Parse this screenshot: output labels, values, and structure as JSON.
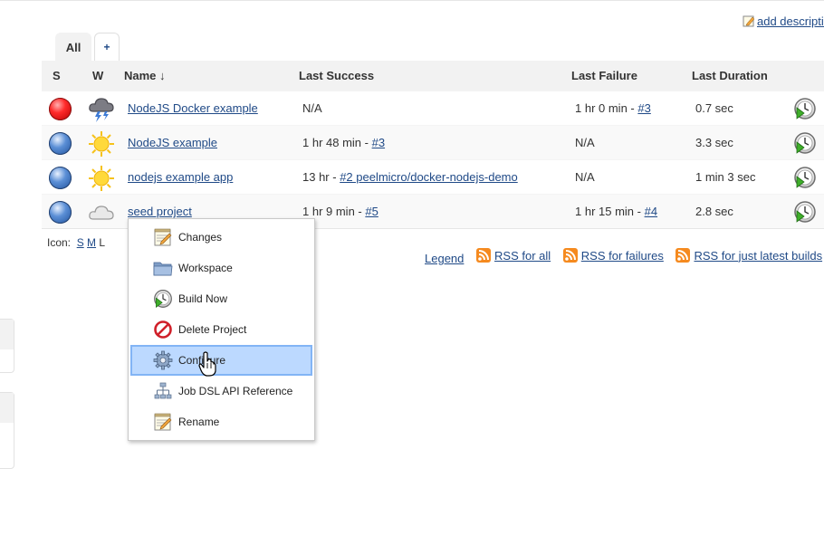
{
  "header": {
    "add_description": "add description"
  },
  "tabs": [
    {
      "label": "All"
    },
    {
      "label": "+"
    }
  ],
  "table": {
    "columns": {
      "s": "S",
      "w": "W",
      "name": "Name",
      "sort_arrow": "↓",
      "last_success": "Last Success",
      "last_failure": "Last Failure",
      "last_duration": "Last Duration"
    },
    "rows": [
      {
        "status": "red",
        "weather": "thunderstorm-icon",
        "name": "NodeJS Docker example",
        "last_success": "N/A",
        "last_failure_text": "1 hr 0 min - ",
        "last_failure_link": "#3",
        "last_duration": "0.7 sec"
      },
      {
        "status": "blue",
        "weather": "sunny-icon",
        "name": "NodeJS example",
        "last_success_text": "1 hr 48 min - ",
        "last_success_link": "#3",
        "last_failure": "N/A",
        "last_duration": "3.3 sec"
      },
      {
        "status": "blue",
        "weather": "sunny-icon",
        "name": "nodejs example app",
        "last_success_text": "13 hr - ",
        "last_success_link": "#2 peelmicro/docker-nodejs-demo",
        "last_failure": "N/A",
        "last_duration": "1 min 3 sec"
      },
      {
        "status": "blue",
        "weather": "cloudy-icon",
        "name": "seed project",
        "last_success_text": "1 hr 9 min - ",
        "last_success_link": "#5",
        "last_failure_text": "1 hr 15 min - ",
        "last_failure_link": "#4",
        "last_duration": "2.8 sec"
      }
    ]
  },
  "icon_size": {
    "label": "Icon:",
    "s": "S",
    "m": "M",
    "l": "L"
  },
  "footer": {
    "legend": "Legend",
    "rss_all": "RSS for all",
    "rss_failures": "RSS for failures",
    "rss_latest": "RSS for just latest builds"
  },
  "context_menu": {
    "items": [
      {
        "label": "Changes",
        "icon": "notepad-icon"
      },
      {
        "label": "Workspace",
        "icon": "folder-icon"
      },
      {
        "label": "Build Now",
        "icon": "clock-play-icon"
      },
      {
        "label": "Delete Project",
        "icon": "no-entry-icon"
      },
      {
        "label": "Configure",
        "icon": "gear-icon",
        "highlighted": true
      },
      {
        "label": "Job DSL API Reference",
        "icon": "hierarchy-icon"
      },
      {
        "label": "Rename",
        "icon": "notepad-icon"
      }
    ]
  },
  "colors": {
    "link": "#204a87",
    "header_bg": "#f2f2f2",
    "menu_highlight": "#bcd9ff",
    "status_red": "#e01b1b",
    "status_blue": "#3d6fc0"
  }
}
